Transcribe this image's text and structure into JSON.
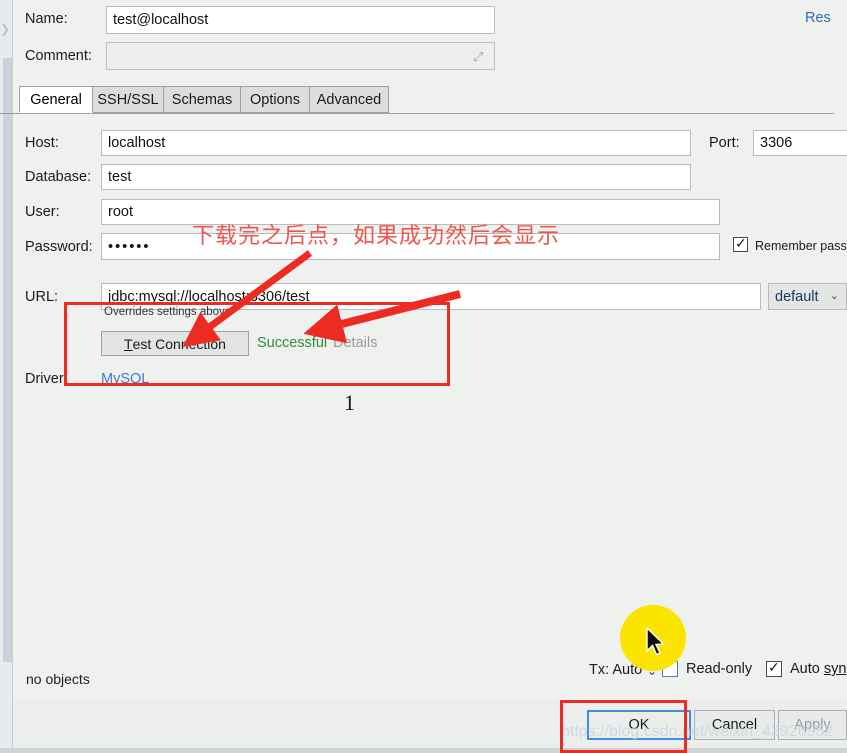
{
  "window": {
    "restore_link": "Res",
    "no_objects": "no objects",
    "watermark": "https://blog.csdn.net/weixin_43926952"
  },
  "header": {
    "name_label": "Name:",
    "name_value": "test@localhost",
    "comment_label": "Comment:",
    "comment_value": "",
    "expand_icon": "⤢"
  },
  "tabs": [
    {
      "label": "General",
      "active": true
    },
    {
      "label": "SSH/SSL",
      "active": false
    },
    {
      "label": "Schemas",
      "active": false
    },
    {
      "label": "Options",
      "active": false
    },
    {
      "label": "Advanced",
      "active": false
    }
  ],
  "general": {
    "host_label": "Host:",
    "host_value": "localhost",
    "port_label": "Port:",
    "port_value": "3306",
    "database_label": "Database:",
    "database_value": "test",
    "user_label": "User:",
    "user_value": "root",
    "password_label": "Password:",
    "password_value": "••••••",
    "remember_password_label": "Remember passwo",
    "remember_password_checked": "✓",
    "url_label": "URL:",
    "url_value": "jdbc:mysql://localhost:3306/test",
    "url_mode_value": "default",
    "url_mode_chevron": "⌄",
    "overrides_note": "Overrides settings above",
    "test_connection_label": "est Connection",
    "test_connection_mnemonic": "T",
    "status_text": "Successful",
    "details_label": "Details",
    "driver_label": "Driver:",
    "driver_value": "MySQL"
  },
  "statusbar": {
    "tx_label": "Tx: Auto",
    "tx_chevron": "⌄",
    "readonly_label": "Read-only",
    "autosync_prefix": "Auto ",
    "autosync_mnemonic": "syn",
    "autosync_checked": "✓"
  },
  "buttons": {
    "ok": "OK",
    "cancel": "Cancel",
    "apply": "Apply"
  },
  "annotations": {
    "chinese_note": "下载完之后点，如果成功然后会显示",
    "step_number": "1",
    "box_color": "#ee2b23",
    "arrow_color": "#ee2b23",
    "highlight_color": "#fbe400"
  },
  "colors": {
    "accent_link": "#3d7cc9",
    "success": "#2e8b36",
    "panel_bg": "#eff1ef",
    "field_bg": "#ffffff",
    "focus_border": "#3f8ddb"
  }
}
